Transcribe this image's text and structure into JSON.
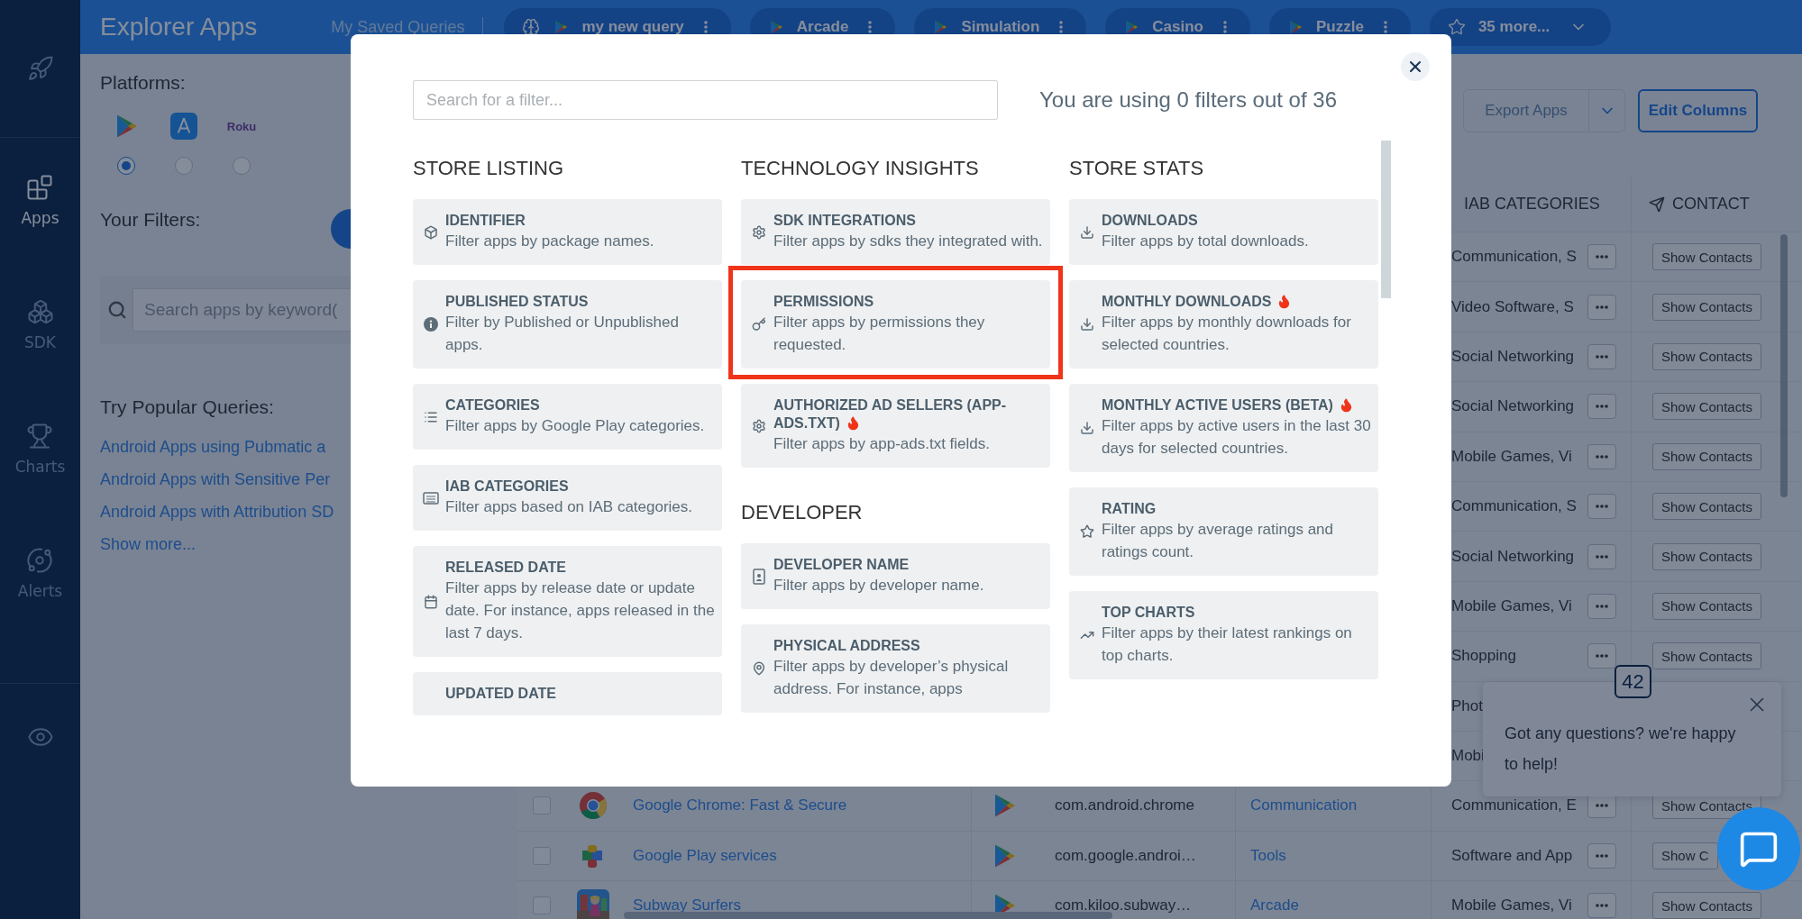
{
  "sidebar": {
    "items": [
      {
        "label": "Apps",
        "selected": true
      },
      {
        "label": "SDK",
        "selected": false
      },
      {
        "label": "Charts",
        "selected": false
      },
      {
        "label": "Alerts",
        "selected": false
      }
    ]
  },
  "header": {
    "title": "Explorer Apps",
    "saved_label": "My Saved Queries",
    "saved_queries": [
      {
        "name": "my new query"
      },
      {
        "name": "Arcade"
      },
      {
        "name": "Simulation"
      },
      {
        "name": "Casino"
      },
      {
        "name": "Puzzle"
      }
    ],
    "more": "35 more..."
  },
  "platforms": {
    "label": "Platforms:",
    "options": [
      {
        "kind": "google-play",
        "selected": true
      },
      {
        "kind": "app-store",
        "selected": false
      },
      {
        "kind": "roku",
        "label": "Roku",
        "selected": false
      }
    ]
  },
  "filters_label": "Your Filters:",
  "search": {
    "placeholder": "Search apps by keyword("
  },
  "popular": {
    "title": "Try Popular Queries:",
    "links": [
      "Android Apps using Pubmatic a",
      "Android Apps with Sensitive Per",
      "Android Apps with Attribution SD"
    ],
    "more": "Show more..."
  },
  "toolbar": {
    "export": "Export Apps",
    "edit_columns": "Edit Columns"
  },
  "table": {
    "columns": [
      "IAB CATEGORIES",
      "CONTACT"
    ],
    "partly_hidden_rows": [
      {
        "iab": "Communication, S",
        "contact": "Show Contacts"
      },
      {
        "iab": "Video Software, S",
        "contact": "Show Contacts"
      },
      {
        "iab": "Social Networking",
        "contact": "Show Contacts"
      },
      {
        "iab": "Social Networking",
        "contact": "Show Contacts"
      },
      {
        "iab": "Mobile Games, Vi",
        "contact": "Show Contacts"
      },
      {
        "iab": "Communication, S",
        "contact": "Show Contacts"
      },
      {
        "iab": "Social Networking",
        "contact": "Show Contacts"
      },
      {
        "iab": "Mobile Games, Vi",
        "contact": "Show Contacts"
      },
      {
        "iab": "Shopping",
        "contact": "Show Contacts"
      },
      {
        "iab": "Phot"
      },
      {
        "iab": "Mobi"
      }
    ],
    "rows": [
      {
        "checked": false,
        "name": "Google Chrome: Fast & Secure",
        "package": "com.android.chrome",
        "category": "Communication",
        "iab": "Communication, E",
        "contact": "Show Contacts"
      },
      {
        "checked": false,
        "name": "Google Play services",
        "package": "com.google.androi…",
        "category": "Tools",
        "iab": "Software and App",
        "contact": "Show C"
      },
      {
        "checked": false,
        "name": "Subway Surfers",
        "package": "com.kiloo.subway…",
        "category": "Arcade",
        "iab": "Mobile Games, Vi",
        "contact": "Show Contacts"
      }
    ]
  },
  "dialog": {
    "search_placeholder": "Search for a filter...",
    "usage": "You are using 0 filters out of 36",
    "columns": [
      {
        "sections": [
          {
            "heading": "STORE LISTING",
            "filters": [
              {
                "title": "IDENTIFIER",
                "description": "Filter apps by package names.",
                "hot": false,
                "highlighted": false
              },
              {
                "title": "PUBLISHED STATUS",
                "description": "Filter by Published or Unpublished apps.",
                "hot": false,
                "highlighted": false
              },
              {
                "title": "CATEGORIES",
                "description": "Filter apps by Google Play categories.",
                "hot": false,
                "highlighted": false
              },
              {
                "title": "IAB CATEGORIES",
                "description": "Filter apps based on IAB categories.",
                "hot": false,
                "highlighted": false
              },
              {
                "title": "RELEASED DATE",
                "description": "Filter apps by release date or update date. For instance, apps released in the last 7 days.",
                "hot": false,
                "highlighted": false
              },
              {
                "title": "UPDATED DATE",
                "hot": false,
                "highlighted": false
              }
            ]
          }
        ]
      },
      {
        "sections": [
          {
            "heading": "TECHNOLOGY INSIGHTS",
            "filters": [
              {
                "title": "SDK INTEGRATIONS",
                "description": "Filter apps by sdks they integrated with.",
                "hot": false,
                "highlighted": false
              },
              {
                "title": "PERMISSIONS",
                "description": "Filter apps by permissions they requested.",
                "hot": false,
                "highlighted": true
              },
              {
                "title": "AUTHORIZED AD SELLERS (APP-ADS.TXT)",
                "description": "Filter apps by app-ads.txt fields.",
                "hot": true,
                "highlighted": false
              }
            ]
          },
          {
            "heading": "DEVELOPER",
            "filters": [
              {
                "title": "DEVELOPER NAME",
                "description": "Filter apps by developer name.",
                "hot": false,
                "highlighted": false
              },
              {
                "title": "PHYSICAL ADDRESS",
                "description": "Filter apps by developer’s physical address. For instance, apps",
                "hot": false,
                "highlighted": false
              }
            ]
          }
        ]
      },
      {
        "sections": [
          {
            "heading": "STORE STATS",
            "filters": [
              {
                "title": "DOWNLOADS",
                "description": "Filter apps by total downloads.",
                "hot": false,
                "highlighted": false
              },
              {
                "title": "MONTHLY DOWNLOADS",
                "description": "Filter apps by monthly downloads for selected countries.",
                "hot": true,
                "highlighted": false
              },
              {
                "title": "MONTHLY ACTIVE USERS (BETA)",
                "description": "Filter apps by active users in the last 30 days for selected countries.",
                "hot": true,
                "highlighted": false
              },
              {
                "title": "RATING",
                "description": "Filter apps by average ratings and ratings count.",
                "hot": false,
                "highlighted": false
              },
              {
                "title": "TOP CHARTS",
                "description": "Filter apps by their latest rankings on top charts.",
                "hot": false,
                "highlighted": false
              }
            ]
          }
        ]
      }
    ]
  },
  "chat": {
    "badge": "42",
    "message": "Got any questions? we're happy to help!"
  }
}
